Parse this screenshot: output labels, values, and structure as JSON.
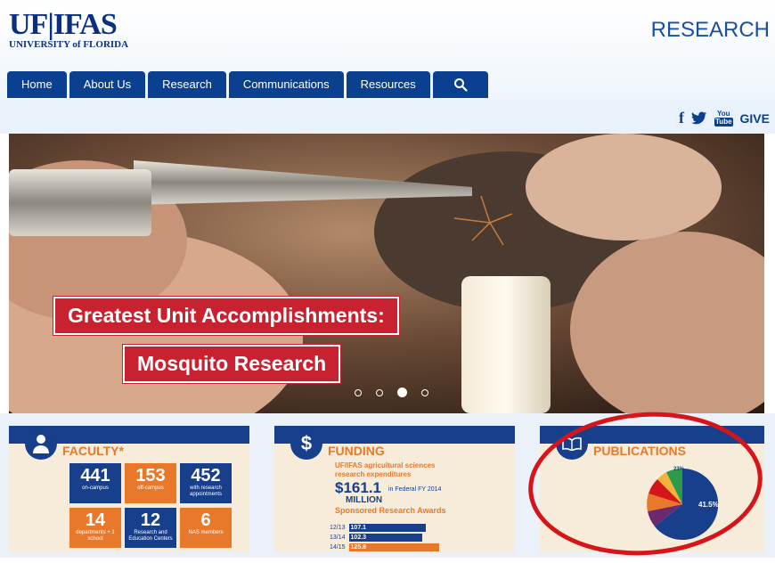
{
  "header": {
    "logo_main": "UF|IFAS",
    "logo_sub": "UNIVERSITY of FLORIDA",
    "section_title": "RESEARCH"
  },
  "nav": {
    "items": [
      "Home",
      "About Us",
      "Research",
      "Communications",
      "Resources"
    ],
    "search_icon": "search-icon"
  },
  "social": {
    "facebook": "f",
    "twitter_icon": "twitter-icon",
    "youtube_top": "You",
    "youtube_bottom": "Tube",
    "give": "GIVE"
  },
  "hero": {
    "headline_1": "Greatest Unit Accomplishments:",
    "headline_2": "Mosquito Research",
    "slide_count": 4,
    "active_slide": 3
  },
  "faculty": {
    "title": "FACULTY*",
    "boxes": [
      {
        "number": "441",
        "label": "on-campus"
      },
      {
        "number": "153",
        "label": "off-campus"
      },
      {
        "number": "452",
        "label": "with research appointments"
      },
      {
        "number": "14",
        "label": "departments + 1 school"
      },
      {
        "number": "12",
        "label": "Research and Education Centers"
      },
      {
        "number": "6",
        "label": "NAS members"
      }
    ]
  },
  "funding": {
    "title": "FUNDING",
    "subtitle_1": "UF/IFAS agricultural sciences",
    "subtitle_2": "research expenditures",
    "amount": "$161.1",
    "amount_suffix": "in Federal FY 2014",
    "amount_unit": "MILLION",
    "awards_title": "Sponsored Research Awards",
    "bars": [
      {
        "year": "12/13",
        "value": "107.1"
      },
      {
        "year": "13/14",
        "value": "102.3"
      },
      {
        "year": "14/15",
        "value": "125.8"
      }
    ]
  },
  "publications": {
    "title": "PUBLICATIONS",
    "pct_main": "41.5%",
    "pct_top": "23%"
  },
  "colors": {
    "uf_blue": "#0b3f8f",
    "uf_orange": "#e8782a",
    "banner_red": "#c8212f",
    "annotation_red": "#d6151b"
  }
}
